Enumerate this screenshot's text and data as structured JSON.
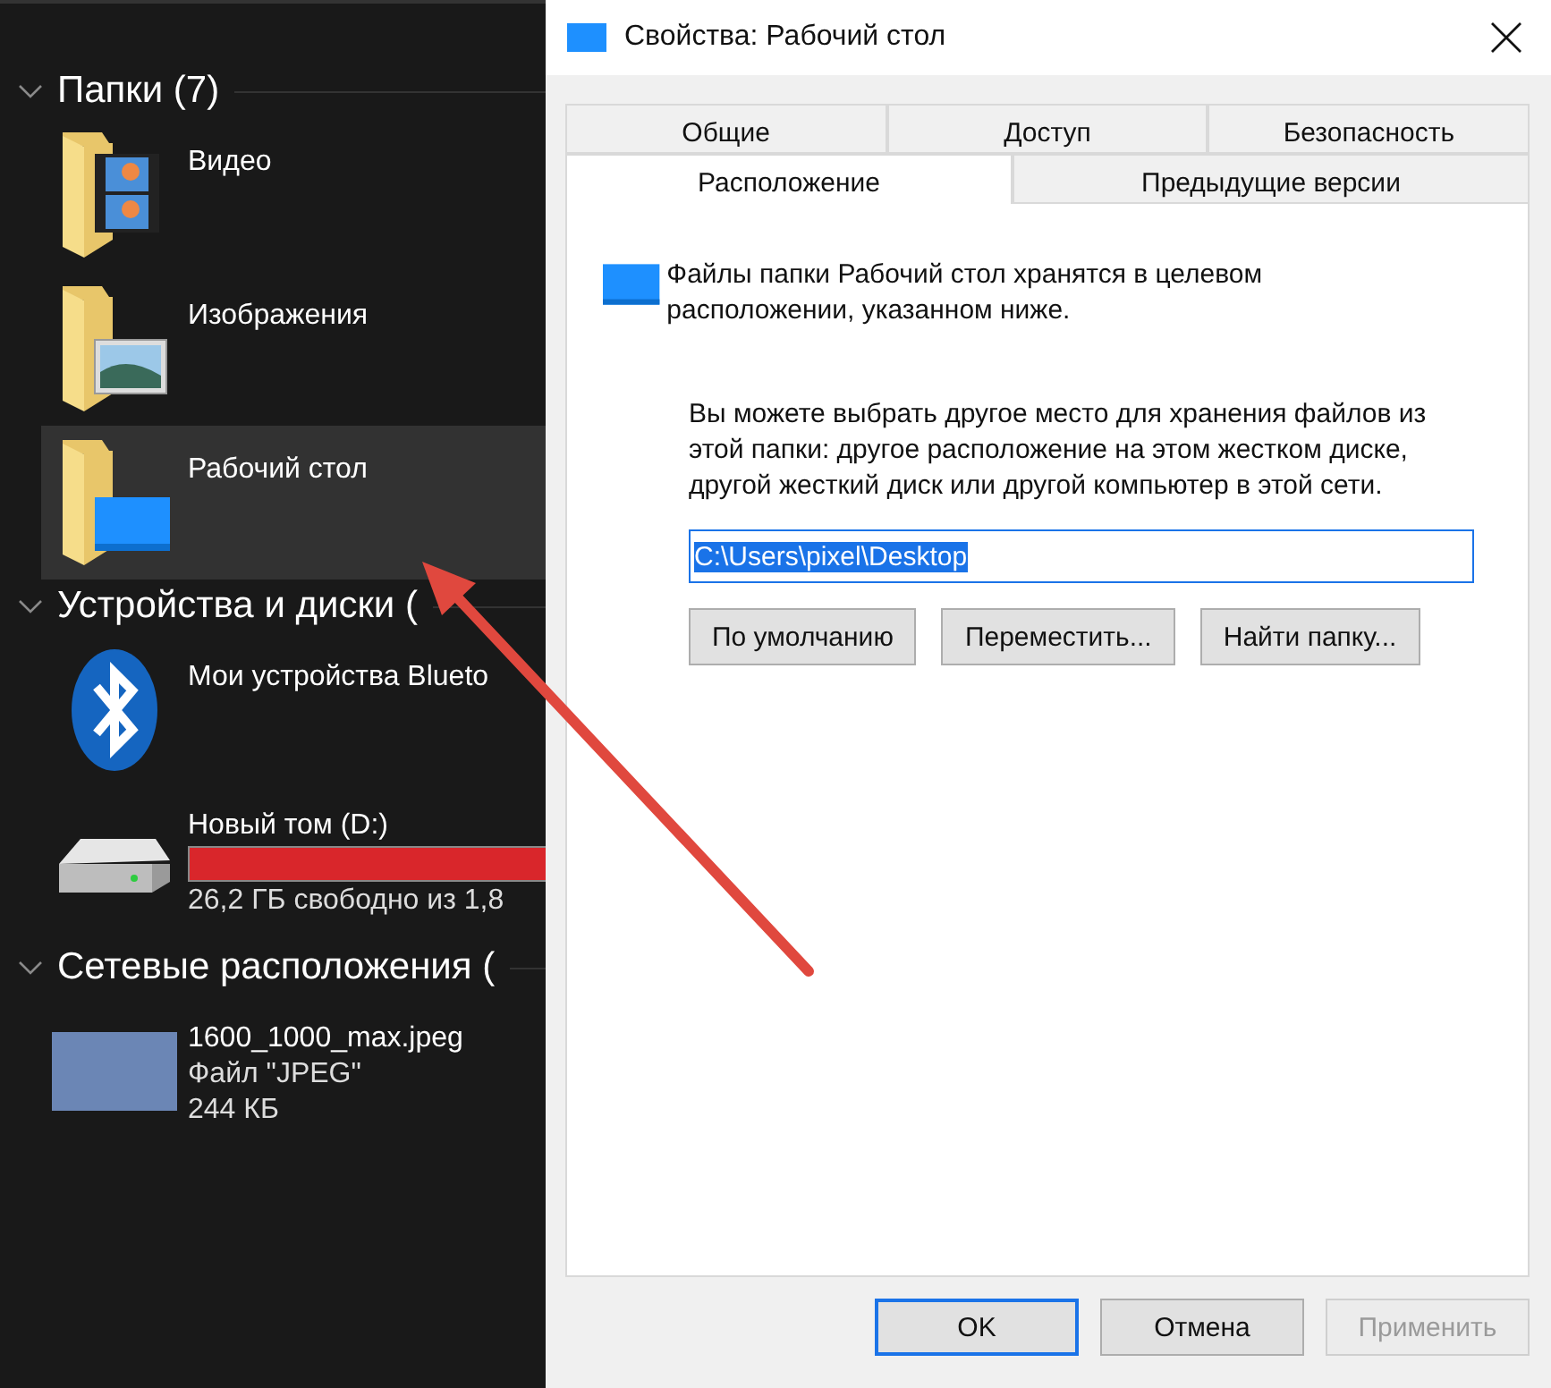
{
  "explorer": {
    "sections": [
      {
        "title": "Папки (7)",
        "expanded": true,
        "items": [
          {
            "kind": "folder-video",
            "name": "Видео",
            "selected": false
          },
          {
            "kind": "folder-pictures",
            "name": "Изображения",
            "selected": false
          },
          {
            "kind": "folder-desktop",
            "name": "Рабочий стол",
            "selected": true
          }
        ]
      },
      {
        "title": "Устройства и диски (",
        "expanded": true,
        "items": [
          {
            "kind": "bluetooth",
            "name": "Мои устройства Blueto",
            "selected": false
          },
          {
            "kind": "drive",
            "name": "Новый том (D:)",
            "level": 0.97,
            "details": [
              "26,2 ГБ свободно из 1,8"
            ],
            "selected": false
          }
        ]
      },
      {
        "title": "Сетевые расположения (",
        "expanded": true,
        "items": [
          {
            "kind": "photo",
            "name": "1600_1000_max.jpeg",
            "details": [
              "Файл \"JPEG\"",
              "244 КБ"
            ],
            "selected": false
          }
        ]
      }
    ]
  },
  "dialog": {
    "title": "Свойства: Рабочий стол",
    "tab_rows": [
      [
        {
          "label": "Общие",
          "selected": false
        },
        {
          "label": "Доступ",
          "selected": false
        },
        {
          "label": "Безопасность",
          "selected": false
        }
      ],
      [
        {
          "label": "Расположение",
          "selected": true
        },
        {
          "label": "Предыдущие версии",
          "selected": false
        }
      ]
    ],
    "intro": "Файлы папки Рабочий стол хранятся в целевом расположении, указанном ниже.",
    "description": "Вы можете выбрать другое место для хранения файлов из этой папки: другое расположение на этом жестком диске, другой жесткий диск или другой компьютер в этой сети.",
    "path": "C:\\Users\\pixel\\Desktop",
    "path_buttons": [
      "По умолчанию",
      "Переместить...",
      "Найти папку..."
    ],
    "footer_buttons": [
      {
        "label": "OK",
        "default": true,
        "disabled": false
      },
      {
        "label": "Отмена",
        "default": false,
        "disabled": false
      },
      {
        "label": "Применить",
        "default": false,
        "disabled": true
      }
    ]
  }
}
